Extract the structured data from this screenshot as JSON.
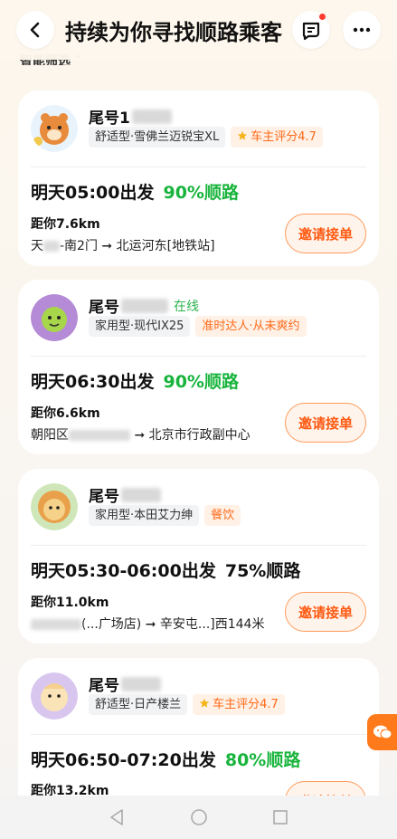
{
  "header": {
    "title": "持续为你寻找顺路乘客",
    "subtitle_peek": "智能筛选 ˅"
  },
  "cards": [
    {
      "name": "尾号1",
      "online": "",
      "car": "舒适型·雪佛兰迈锐宝XL",
      "badge": "车主评分4.7",
      "time": "明天05:00出发",
      "pct": "90%顺路",
      "dist": "距你7.6km",
      "route_from": "天",
      "route_from_tail": "-南2门",
      "route_to": "北运河东[地铁站]",
      "invite": "邀请接单"
    },
    {
      "name": "尾号",
      "online": "在线",
      "car": "家用型·现代IX25",
      "badge": "准时达人·从未爽约",
      "time": "明天06:30出发",
      "pct": "90%顺路",
      "dist": "距你6.6km",
      "route_from": "朝阳区",
      "route_from_tail": "",
      "route_to": "北京市行政副中心",
      "invite": "邀请接单"
    },
    {
      "name": "尾号",
      "online": "",
      "car": "家用型·本田艾力绅",
      "badge": "餐饮",
      "time": "明天05:30-06:00出发",
      "pct": "75%顺路",
      "dist": "距你11.0km",
      "route_from": "",
      "route_from_tail": "(...广场店)",
      "route_to": "辛安屯...]西144米",
      "invite": "邀请接单"
    },
    {
      "name": "尾号",
      "online": "",
      "car": "舒适型·日产楼兰",
      "badge": "车主评分4.7",
      "time": "明天06:50-07:20出发",
      "pct": "80%顺路",
      "dist": "距你13.2km",
      "route_from": "",
      "route_from_tail": "",
      "route_to": "",
      "invite": "邀请接单"
    }
  ],
  "colors": {
    "accent_orange": "#ff5a12",
    "green": "#18b43c",
    "badge_bg": "#fff1e6"
  },
  "icons": {
    "back": "back-arrow-icon",
    "message": "message-icon",
    "more": "more-icon",
    "chat": "chat-icon",
    "star": "star-icon",
    "arrow": "route-arrow-icon"
  }
}
